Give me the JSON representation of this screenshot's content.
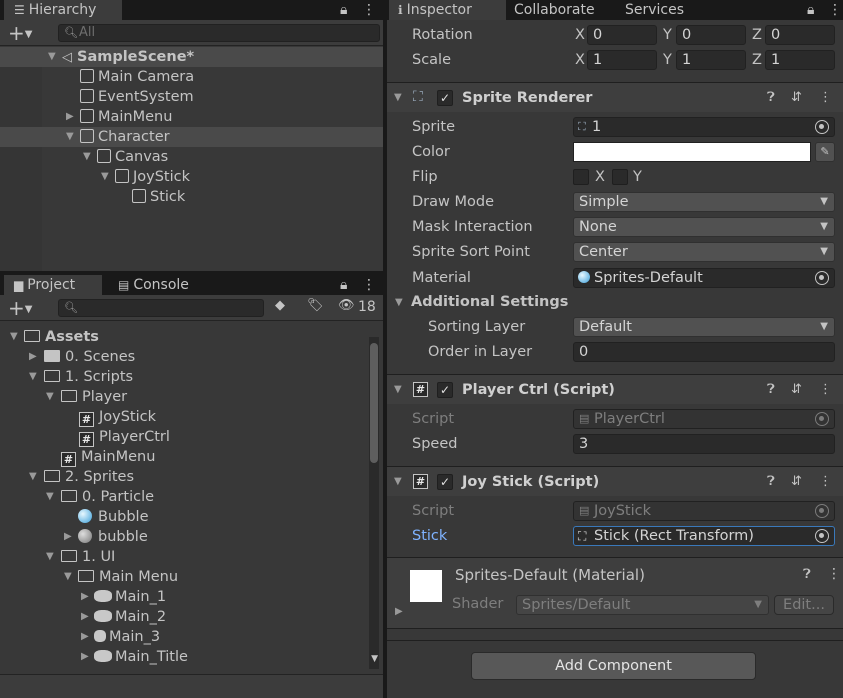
{
  "hierarchy": {
    "tab_label": "Hierarchy",
    "search_placeholder": "All",
    "scene_name": "SampleScene*",
    "items": [
      {
        "label": "Main Camera"
      },
      {
        "label": "EventSystem"
      },
      {
        "label": "MainMenu"
      },
      {
        "label": "Character"
      },
      {
        "label": "Canvas"
      },
      {
        "label": "JoyStick"
      },
      {
        "label": "Stick"
      }
    ]
  },
  "project": {
    "tab_label": "Project",
    "console_label": "Console",
    "hidden_count": "18",
    "items": [
      {
        "label": "Assets"
      },
      {
        "label": "0. Scenes"
      },
      {
        "label": "1. Scripts"
      },
      {
        "label": "Player"
      },
      {
        "label": "JoyStick"
      },
      {
        "label": "PlayerCtrl"
      },
      {
        "label": "MainMenu"
      },
      {
        "label": "2. Sprites"
      },
      {
        "label": "0. Particle"
      },
      {
        "label": "Bubble"
      },
      {
        "label": "bubble"
      },
      {
        "label": "1. UI"
      },
      {
        "label": "Main Menu"
      },
      {
        "label": "Main_1"
      },
      {
        "label": "Main_2"
      },
      {
        "label": "Main_3"
      },
      {
        "label": "Main_Title"
      }
    ]
  },
  "inspector": {
    "tabs": [
      "Inspector",
      "Collaborate",
      "Services"
    ],
    "transform": {
      "rotation_label": "Rotation",
      "scale_label": "Scale",
      "axis_x": "X",
      "axis_y": "Y",
      "axis_z": "Z",
      "rotation": {
        "x": "0",
        "y": "0",
        "z": "0"
      },
      "scale": {
        "x": "1",
        "y": "1",
        "z": "1"
      }
    },
    "sprite_renderer": {
      "title": "Sprite Renderer",
      "sprite_label": "Sprite",
      "sprite_value": "1",
      "color_label": "Color",
      "color_value": "#ffffff",
      "flip_label": "Flip",
      "flip_x": "X",
      "flip_y": "Y",
      "draw_mode_label": "Draw Mode",
      "draw_mode_value": "Simple",
      "mask_label": "Mask Interaction",
      "mask_value": "None",
      "sort_point_label": "Sprite Sort Point",
      "sort_point_value": "Center",
      "material_label": "Material",
      "material_value": "Sprites-Default",
      "additional_label": "Additional Settings",
      "sorting_layer_label": "Sorting Layer",
      "sorting_layer_value": "Default",
      "order_label": "Order in Layer",
      "order_value": "0"
    },
    "player_ctrl": {
      "title": "Player Ctrl (Script)",
      "script_label": "Script",
      "script_value": "PlayerCtrl",
      "speed_label": "Speed",
      "speed_value": "3"
    },
    "joy_stick": {
      "title": "Joy Stick (Script)",
      "script_label": "Script",
      "script_value": "JoyStick",
      "stick_label": "Stick",
      "stick_value": "Stick (Rect Transform)"
    },
    "material": {
      "title": "Sprites-Default (Material)",
      "shader_label": "Shader",
      "shader_value": "Sprites/Default",
      "edit_label": "Edit..."
    },
    "add_component_label": "Add Component"
  }
}
